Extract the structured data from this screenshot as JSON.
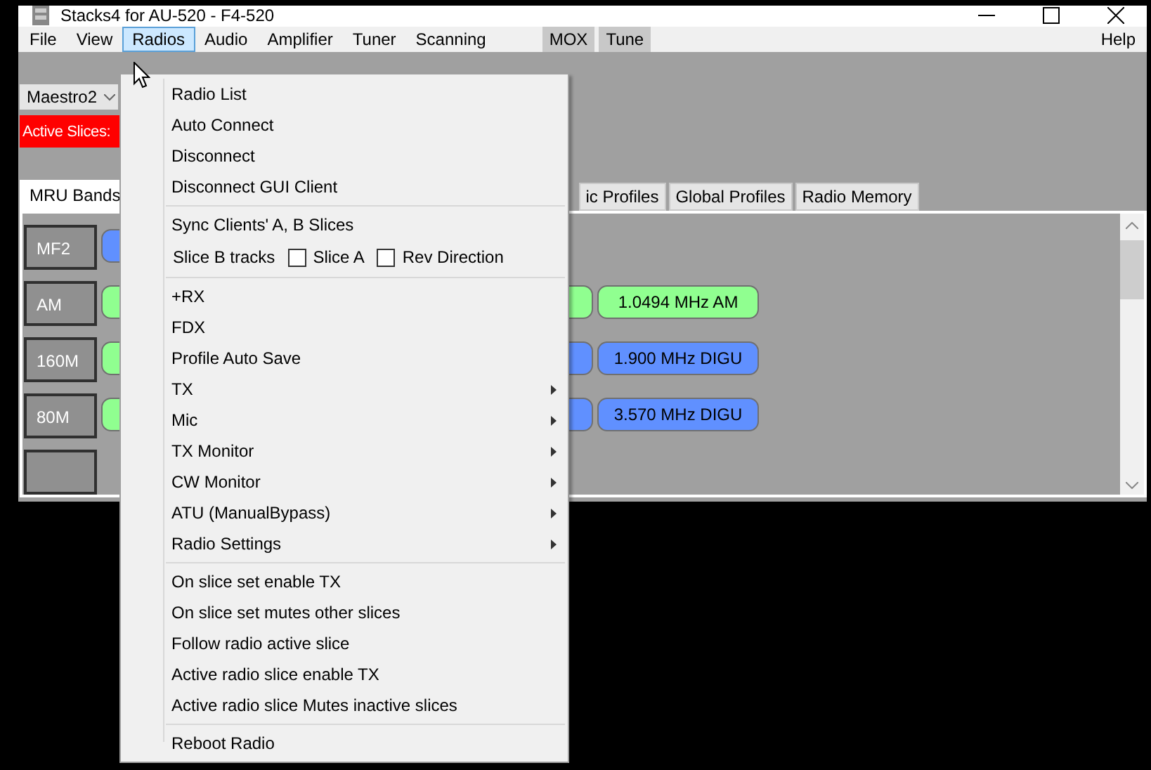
{
  "window": {
    "title": "Stacks4 for AU-520 - F4-520"
  },
  "menu_bar": [
    {
      "label": "File",
      "selected": false
    },
    {
      "label": "View",
      "selected": false
    },
    {
      "label": "Radios",
      "selected": true
    },
    {
      "label": "Audio",
      "selected": false
    },
    {
      "label": "Amplifier",
      "selected": false
    },
    {
      "label": "Tuner",
      "selected": false
    },
    {
      "label": "Scanning",
      "selected": false
    }
  ],
  "toggles": [
    "MOX",
    "Tune"
  ],
  "help": "Help",
  "radio_select": {
    "value": "Maestro2"
  },
  "active_slices": "Active Slices:",
  "tabs": [
    {
      "label": "MRU Bands",
      "selected": true
    },
    {
      "label": "ic Profiles",
      "selected": false
    },
    {
      "label": "Global Profiles",
      "selected": false
    },
    {
      "label": "Radio Memory",
      "selected": false
    }
  ],
  "bands": [
    {
      "label": "MF2",
      "slices": [
        {
          "color": "#6090ff"
        }
      ]
    },
    {
      "label": "AM",
      "slices": [
        {
          "color": "#90ff90"
        },
        {
          "color": "#90ff90"
        },
        {
          "color": "#90ff90",
          "text": "1.0494 MHz AM"
        }
      ]
    },
    {
      "label": "160M",
      "slices": [
        {
          "color": "#90ff90"
        },
        {
          "color": "#6090ff"
        },
        {
          "color": "#6090ff",
          "text": "1.900 MHz DIGU"
        }
      ]
    },
    {
      "label": "80M",
      "slices": [
        {
          "color": "#90ff90"
        },
        {
          "color": "#6090ff"
        },
        {
          "color": "#6090ff",
          "text": "3.570 MHz DIGU"
        }
      ]
    }
  ],
  "dropdown": [
    {
      "kind": "item",
      "label": "Radio List"
    },
    {
      "kind": "item",
      "label": "Auto Connect"
    },
    {
      "kind": "item",
      "label": "Disconnect"
    },
    {
      "kind": "item",
      "label": "Disconnect GUI Client"
    },
    {
      "kind": "separator"
    },
    {
      "kind": "item",
      "label": "Sync Clients' A, B Slices"
    },
    {
      "kind": "checks",
      "label": "Slice B tracks",
      "options": [
        {
          "label": "Slice A",
          "checked": false
        },
        {
          "label": "Rev Direction",
          "checked": false
        }
      ]
    },
    {
      "kind": "separator"
    },
    {
      "kind": "item",
      "label": "+RX"
    },
    {
      "kind": "item",
      "label": "FDX"
    },
    {
      "kind": "item",
      "label": "Profile Auto Save"
    },
    {
      "kind": "submenu",
      "label": "TX"
    },
    {
      "kind": "submenu",
      "label": "Mic"
    },
    {
      "kind": "submenu",
      "label": "TX Monitor"
    },
    {
      "kind": "submenu",
      "label": "CW Monitor"
    },
    {
      "kind": "submenu",
      "label": "ATU  (ManualBypass)"
    },
    {
      "kind": "submenu",
      "label": "Radio Settings"
    },
    {
      "kind": "separator"
    },
    {
      "kind": "item",
      "label": "On slice set enable TX"
    },
    {
      "kind": "item",
      "label": "On slice set mutes other slices"
    },
    {
      "kind": "item",
      "label": "Follow radio active slice"
    },
    {
      "kind": "item",
      "label": "Active radio slice enable TX"
    },
    {
      "kind": "item",
      "label": "Active radio slice Mutes inactive slices"
    },
    {
      "kind": "separator"
    },
    {
      "kind": "item",
      "label": "Reboot Radio"
    }
  ]
}
